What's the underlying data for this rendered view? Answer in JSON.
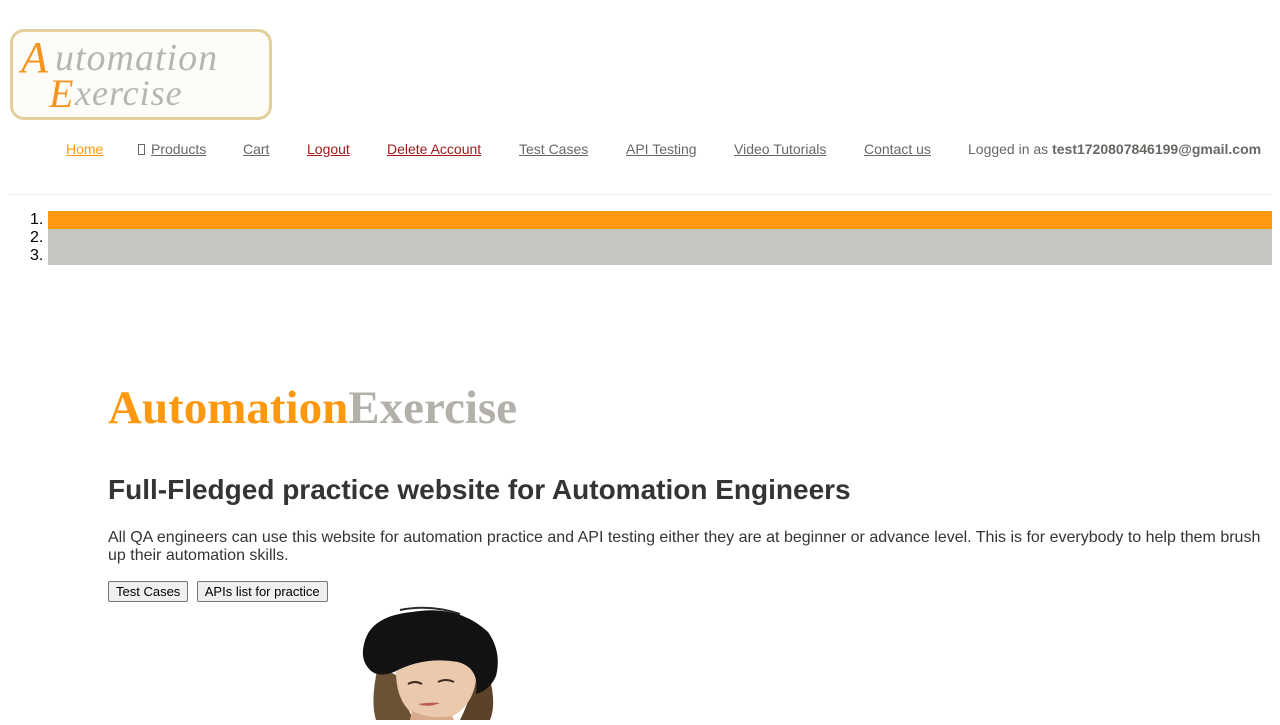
{
  "logo": {
    "line1": "Automation",
    "line2": "Exercise"
  },
  "nav": {
    "home": "Home",
    "products": "Products",
    "products_icon": "product-icon",
    "cart": "Cart",
    "logout": "Logout",
    "delete_account": "Delete Account",
    "test_cases": "Test Cases",
    "api_testing": "API Testing",
    "video_tutorials": "Video Tutorials",
    "contact_us": "Contact us",
    "logged_in_prefix": "Logged in as",
    "logged_in_user": "test1720807846199@gmail.com"
  },
  "carousel": {
    "indicators": [
      {
        "number": "1.",
        "active": true
      },
      {
        "number": "2.",
        "active": false
      },
      {
        "number": "3.",
        "active": false
      }
    ],
    "active_color": "#FE980F",
    "inactive_color": "#C5C6C0"
  },
  "hero": {
    "brand_part1": "Automation",
    "brand_part2": "Exercise",
    "title": "Full-Fledged practice website for Automation Engineers",
    "description": "All QA engineers can use this website for automation practice and API testing either they are at beginner or advance level. This is for everybody to help them brush up their automation skills.",
    "button_test_cases": "Test Cases",
    "button_apis": "APIs list for practice"
  },
  "colors": {
    "accent": "#FE980F",
    "brand_gray": "#B3B0A9",
    "text_dark": "#363432",
    "text_nav": "#696763"
  }
}
